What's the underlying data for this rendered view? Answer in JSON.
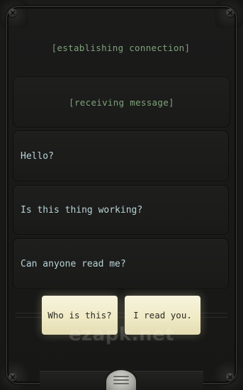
{
  "messages": [
    {
      "text": "[establishing connection]",
      "kind": "system"
    },
    {
      "text": "[receiving message]",
      "kind": "system"
    },
    {
      "text": "Hello?",
      "kind": "incoming"
    },
    {
      "text": "Is this thing working?",
      "kind": "incoming"
    },
    {
      "text": "Can anyone read me?",
      "kind": "incoming"
    }
  ],
  "choices": [
    {
      "label": "Who is this?"
    },
    {
      "label": "I read you."
    }
  ],
  "watermark": "ezapk.net",
  "colors": {
    "system_text": "#7fa27b",
    "incoming_text": "#b9d4d6",
    "choice_bg": "#efe9c4",
    "background": "#1b1b1a"
  },
  "icons": {
    "menu": "menu-handle-icon",
    "screw": "screw-icon"
  }
}
